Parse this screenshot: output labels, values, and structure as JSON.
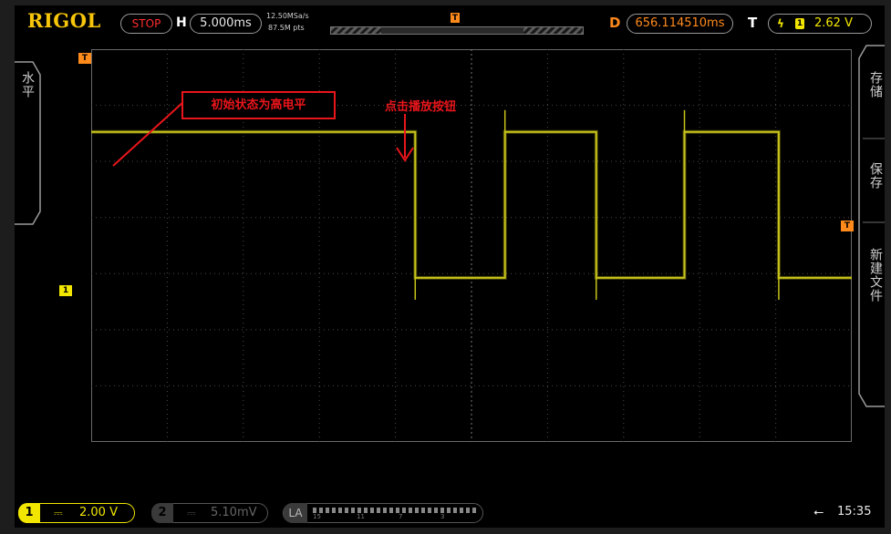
{
  "brand": "RIGOL",
  "top_bar": {
    "run_state": "STOP",
    "horizontal_label": "H",
    "timebase": "5.000ms",
    "sample_rate": "12.50MSa/s",
    "memory_depth": "87.5M pts",
    "delay_label": "D",
    "delay_value": "656.114510ms",
    "trigger_label": "T",
    "trigger_edge": "rising-edge-icon",
    "trigger_channel": "1",
    "trigger_level": "2.62 V"
  },
  "left_menu": {
    "horizontal_label": "水平"
  },
  "right_menu": {
    "store_label": "存储",
    "save_label": "保存",
    "new_file_label": "新建文件"
  },
  "annotations": {
    "initial_state": "初始状态为高电平",
    "press_play": "点击播放按钮"
  },
  "markers": {
    "trigger_pos": "T",
    "trigger_level": "T",
    "channel1_ground": "1"
  },
  "bottom_bar": {
    "ch1_number": "1",
    "ch1_coupling_icon": "dc-coupling-icon",
    "ch1_scale": "2.00 V",
    "ch2_number": "2",
    "ch2_coupling_icon": "dc-coupling-icon",
    "ch2_scale": "5.10mV",
    "la_label": "LA",
    "la_channel_labels": [
      "15",
      "11",
      "7",
      "3"
    ],
    "usb_icon": "usb-icon",
    "clock": "15:35"
  },
  "colors": {
    "trace_ch1": "#c8c41a",
    "brand": "#f7c60a",
    "delay": "#ff8a1c",
    "annotation_red": "#e8151b",
    "ch1_badge": "#f2e600"
  },
  "chart_data": {
    "type": "line",
    "title": "",
    "xlabel": "",
    "ylabel": "",
    "x_unit": "ms",
    "y_unit": "V",
    "x_per_div": 5,
    "y_per_div": 2,
    "xlim": [
      -25,
      25
    ],
    "ylim": [
      -6,
      8
    ],
    "grid": true,
    "series": [
      {
        "name": "1",
        "x": [
          -25,
          -3.7,
          -3.7,
          2.2,
          2.2,
          8.2,
          8.2,
          14.0,
          14.0,
          20.2,
          20.2,
          25
        ],
        "y": [
          5.05,
          5.05,
          -0.15,
          -0.15,
          5.05,
          5.05,
          -0.15,
          -0.15,
          5.05,
          5.05,
          -0.15,
          -0.15
        ]
      }
    ],
    "trigger_level": 2.62
  }
}
